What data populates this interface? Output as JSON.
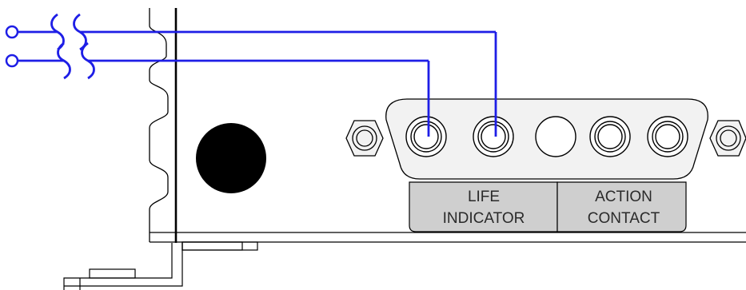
{
  "labels": {
    "life_indicator_line1": "LIFE",
    "life_indicator_line2": "INDICATOR",
    "action_contact_line1": "ACTION",
    "action_contact_line2": "CONTACT"
  },
  "colors": {
    "wire": "#1e1ee6",
    "outline": "#000000",
    "label_panel": "#cfcfcf",
    "connector_fill": "#f2f2f2",
    "hole": "#000000"
  },
  "icons": {
    "wire_terminal": "open-circle",
    "wire_break": "s-break-symbol",
    "connector": "d-sub-connector",
    "jack_screw": "hex-nut",
    "mounting_hole": "filled-circle"
  }
}
